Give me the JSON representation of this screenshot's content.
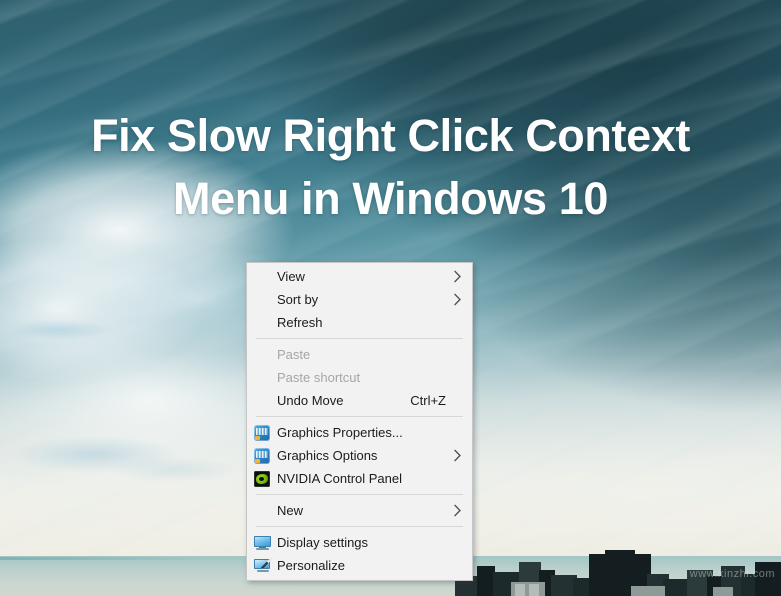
{
  "headline": {
    "line1": "Fix Slow Right Click Context",
    "line2": "Menu in Windows 10"
  },
  "wallpaper": {
    "watermark": "www.xinzhi.com",
    "sky_top_color": "#2e5f6c",
    "sky_bottom_color": "#e9e8e0",
    "sea_color": "#b9cfcb",
    "city_color": "#1d2a2c"
  },
  "context_menu": {
    "background_color": "#f2f2f2",
    "border_color": "#c6c6c6",
    "text_color": "#1b1b1b",
    "disabled_color": "#a6a6a6",
    "groups": [
      {
        "items": [
          {
            "label": "View",
            "icon": null,
            "accel": "",
            "submenu": true,
            "disabled": false
          },
          {
            "label": "Sort by",
            "icon": null,
            "accel": "",
            "submenu": true,
            "disabled": false
          },
          {
            "label": "Refresh",
            "icon": null,
            "accel": "",
            "submenu": false,
            "disabled": false
          }
        ]
      },
      {
        "items": [
          {
            "label": "Paste",
            "icon": null,
            "accel": "",
            "submenu": false,
            "disabled": true
          },
          {
            "label": "Paste shortcut",
            "icon": null,
            "accel": "",
            "submenu": false,
            "disabled": true
          },
          {
            "label": "Undo Move",
            "icon": null,
            "accel": "Ctrl+Z",
            "submenu": false,
            "disabled": false
          }
        ]
      },
      {
        "items": [
          {
            "label": "Graphics Properties...",
            "icon": "intel-graphics-icon",
            "accel": "",
            "submenu": false,
            "disabled": false
          },
          {
            "label": "Graphics Options",
            "icon": "intel-graphics-icon",
            "accel": "",
            "submenu": true,
            "disabled": false
          },
          {
            "label": "NVIDIA Control Panel",
            "icon": "nvidia-icon",
            "accel": "",
            "submenu": false,
            "disabled": false
          }
        ]
      },
      {
        "items": [
          {
            "label": "New",
            "icon": null,
            "accel": "",
            "submenu": true,
            "disabled": false
          }
        ]
      },
      {
        "items": [
          {
            "label": "Display settings",
            "icon": "monitor-icon",
            "accel": "",
            "submenu": false,
            "disabled": false
          },
          {
            "label": "Personalize",
            "icon": "personalize-icon",
            "accel": "",
            "submenu": false,
            "disabled": false
          }
        ]
      }
    ]
  }
}
